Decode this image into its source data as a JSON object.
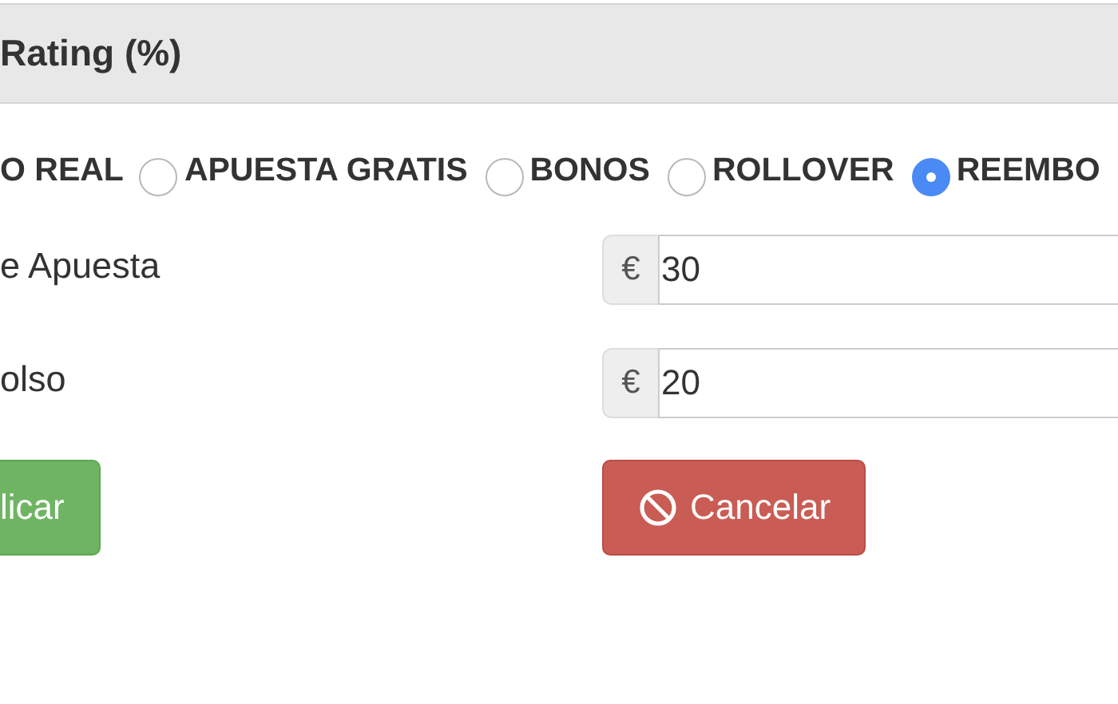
{
  "panel": {
    "title": "Rating (%)"
  },
  "bet_types": [
    {
      "kind": "cut",
      "label": "O REAL"
    },
    {
      "kind": "radio",
      "label": "APUESTA GRATIS",
      "selected": false
    },
    {
      "kind": "radio",
      "label": "BONOS",
      "selected": false
    },
    {
      "kind": "radio",
      "label": "ROLLOVER",
      "selected": false
    },
    {
      "kind": "radio",
      "label": "REEMBO",
      "selected": true
    }
  ],
  "fields": [
    {
      "label": "e Apuesta",
      "addon": "€",
      "value": "30"
    },
    {
      "label": "olso",
      "addon": "€",
      "value": "20"
    }
  ],
  "buttons": [
    {
      "kind": "apply",
      "label": "licar"
    },
    {
      "kind": "cancel",
      "label": "Cancelar"
    }
  ]
}
